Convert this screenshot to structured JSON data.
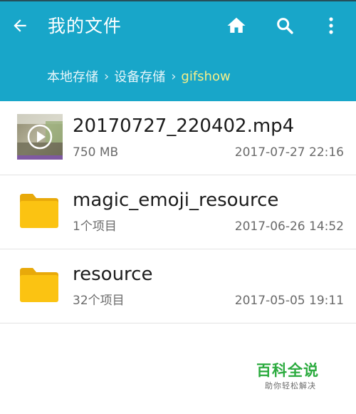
{
  "header": {
    "title": "我的文件",
    "back_icon": "arrow-left-icon",
    "actions": [
      "home-icon",
      "search-icon",
      "more-vert-icon"
    ]
  },
  "breadcrumb": {
    "items": [
      "本地存储",
      "设备存储",
      "gifshow"
    ],
    "separator": "›"
  },
  "files": [
    {
      "name": "20170727_220402.mp4",
      "meta": "750 MB",
      "date": "2017-07-27 22:16",
      "type": "video"
    },
    {
      "name": "magic_emoji_resource",
      "meta": "1个项目",
      "date": "2017-06-26 14:52",
      "type": "folder"
    },
    {
      "name": "resource",
      "meta": "32个项目",
      "date": "2017-05-05 19:11",
      "type": "folder"
    }
  ],
  "watermark": {
    "title": "百科全说",
    "subtitle": "助你轻松解决"
  },
  "colors": {
    "appbar": "#18a6c9",
    "breadcrumb_current": "#f6ef88",
    "folder": "#fbc312",
    "watermark_green": "#2bab3e"
  }
}
